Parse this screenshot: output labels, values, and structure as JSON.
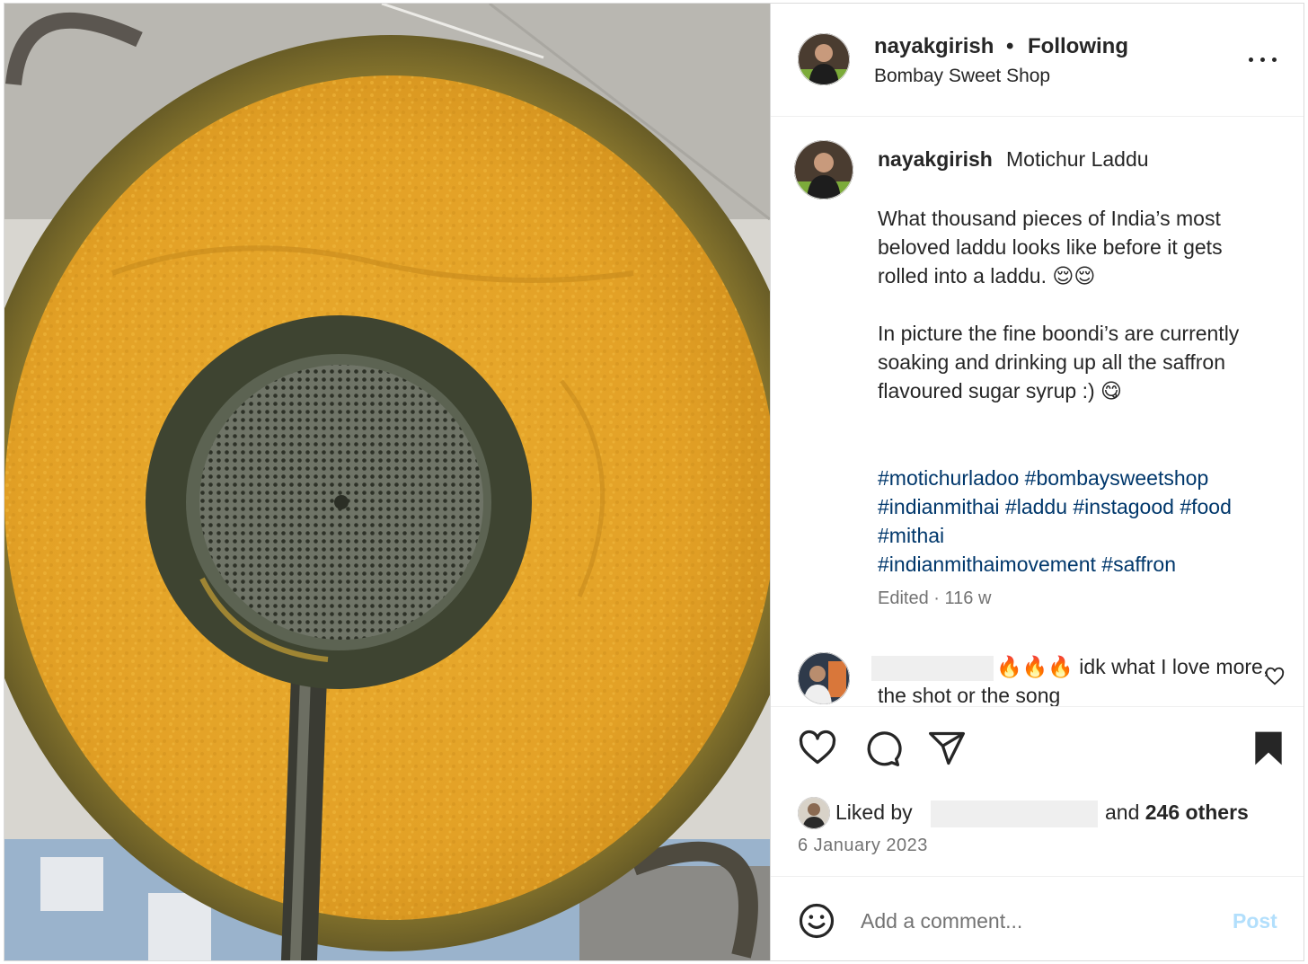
{
  "header": {
    "username": "nayakgirish",
    "separator": "•",
    "follow_status": "Following",
    "location": "Bombay Sweet Shop",
    "more_icon": "more-horizontal-icon"
  },
  "caption": {
    "username": "nayakgirish",
    "title": "Motichur Laddu",
    "paragraph_1": "What thousand pieces of India’s most beloved laddu looks like before it gets rolled into a laddu. 😌😌",
    "paragraph_2": "In picture the fine boondi’s are currently soaking and drinking up all the saffron flavoured sugar syrup :) 😋",
    "hashtags": [
      "#motichurladoo",
      "#bombaysweetshop",
      "#indianmithai",
      "#laddu",
      "#instagood",
      "#food",
      "#mithai",
      "#indianmithaimovement",
      "#saffron"
    ],
    "edited": "Edited",
    "age": "116 w"
  },
  "comment": {
    "text": "🔥🔥🔥 idk what I love more, the shot or the song",
    "like_icon": "heart-outline-icon"
  },
  "actions": {
    "like_icon": "heart-outline-icon",
    "comment_icon": "comment-bubble-icon",
    "share_icon": "paper-plane-icon",
    "save_icon": "bookmark-filled-icon"
  },
  "likes": {
    "prefix": "Liked by",
    "and": "and",
    "others": "246 others"
  },
  "post_date": "6 January 2023",
  "add_comment": {
    "placeholder": "Add a comment...",
    "post_label": "Post",
    "emoji_icon": "smiley-icon"
  },
  "colors": {
    "hashtag": "#00376b",
    "post_disabled": "#b2dffc",
    "secondary_text": "#737373",
    "laddu": "#e8a72b"
  }
}
